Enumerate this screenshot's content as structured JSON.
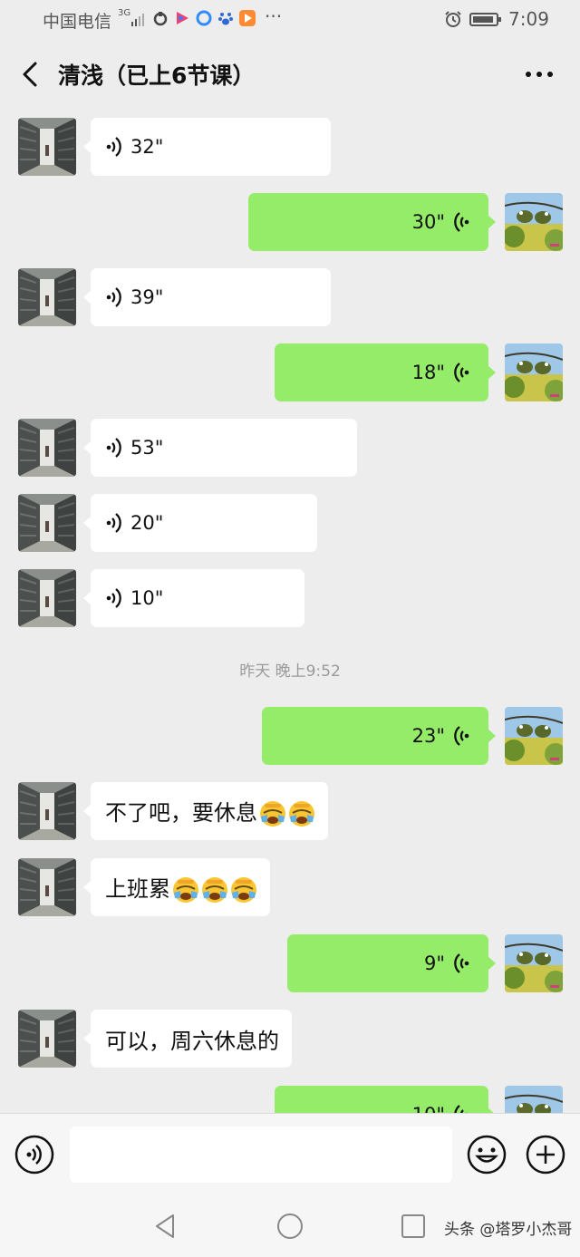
{
  "status_bar": {
    "carrier": "中国电信",
    "network": "3G",
    "more": "···",
    "time": "7:09"
  },
  "header": {
    "title": "清浅（已上6节课）"
  },
  "messages": [
    {
      "side": "in",
      "kind": "voice",
      "duration": "32\""
    },
    {
      "side": "out",
      "kind": "voice",
      "duration": "30\""
    },
    {
      "side": "in",
      "kind": "voice",
      "duration": "39\""
    },
    {
      "side": "out",
      "kind": "voice",
      "duration": "18\""
    },
    {
      "side": "in",
      "kind": "voice",
      "duration": "53\""
    },
    {
      "side": "in",
      "kind": "voice",
      "duration": "20\""
    },
    {
      "side": "in",
      "kind": "voice",
      "duration": "10\""
    },
    {
      "kind": "timestamp",
      "text": "昨天 晚上9:52"
    },
    {
      "side": "out",
      "kind": "voice",
      "duration": "23\""
    },
    {
      "side": "in",
      "kind": "text",
      "text": "不了吧，要休息",
      "emoji": "face-palm-crying",
      "emoji_count": 2
    },
    {
      "side": "in",
      "kind": "text",
      "text": "上班累",
      "emoji": "face-palm-crying",
      "emoji_count": 3
    },
    {
      "side": "out",
      "kind": "voice",
      "duration": "9\""
    },
    {
      "side": "in",
      "kind": "text",
      "text": "可以，周六休息的"
    },
    {
      "side": "out",
      "kind": "voice",
      "duration": "10\""
    }
  ],
  "input_bar": {
    "placeholder": "",
    "icons": [
      "voice-icon",
      "emoji-icon",
      "plus-icon"
    ]
  },
  "nav_bar": {
    "icons": [
      "back-triangle-icon",
      "home-circle-icon",
      "recents-square-icon"
    ],
    "watermark": "头条 @塔罗小杰哥"
  },
  "colors": {
    "background": "#ededed",
    "outgoing_bubble": "#95ec69",
    "incoming_bubble": "#ffffff",
    "timestamp_text": "#9a9a9a"
  }
}
